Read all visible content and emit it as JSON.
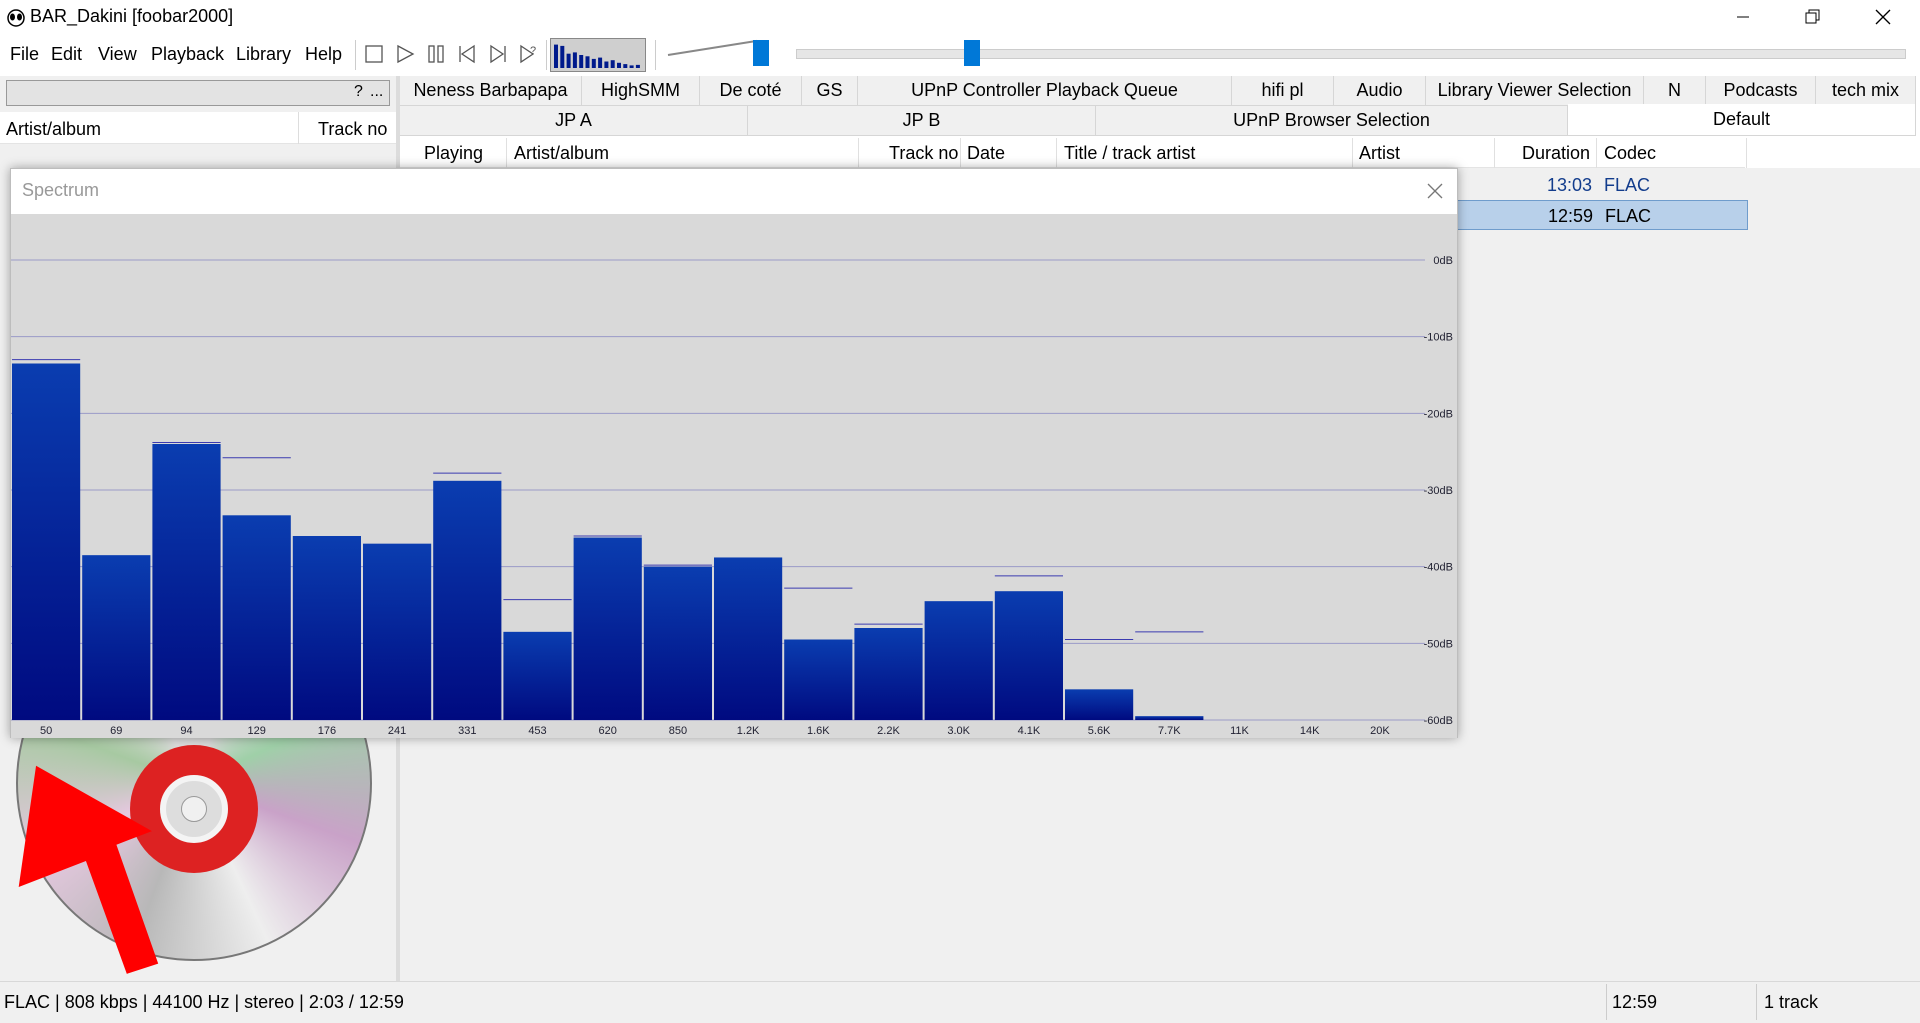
{
  "window": {
    "title": "BAR_Dakini  [foobar2000]"
  },
  "menu": [
    "File",
    "Edit",
    "View",
    "Playback",
    "Library",
    "Help"
  ],
  "toolbar": {
    "icons": [
      "stop-icon",
      "play-icon",
      "pause-icon",
      "previous-icon",
      "next-icon",
      "random-icon"
    ],
    "mini_spectrum_levels": [
      0.9,
      0.85,
      0.55,
      0.6,
      0.5,
      0.45,
      0.35,
      0.4,
      0.25,
      0.3,
      0.2,
      0.15,
      0.1,
      0.12
    ]
  },
  "library": {
    "search_q": "?",
    "search_more": "...",
    "columns": [
      "Artist/album",
      "Track no"
    ]
  },
  "tabs_row1": [
    "Neness Barbapapa",
    "HighSMM",
    "De coté",
    "GS",
    "UPnP Controller Playback Queue",
    "hifi pl",
    "Audio",
    "Library Viewer Selection",
    "N",
    "Podcasts",
    "tech mix"
  ],
  "tabs_row2": [
    "JP A",
    "JP B",
    "UPnP Browser Selection",
    "Default"
  ],
  "playlist": {
    "columns": [
      "Playing",
      "Artist/album",
      "Track no",
      "Date",
      "Title / track artist",
      "Artist",
      "Duration",
      "Codec"
    ],
    "rows": [
      {
        "duration": "13:03",
        "codec": "FLAC",
        "selected": false
      },
      {
        "duration": "12:59",
        "codec": "FLAC",
        "selected": true
      }
    ]
  },
  "spectrum": {
    "title": "Spectrum",
    "chart_data": {
      "type": "bar",
      "categories": [
        "50",
        "69",
        "94",
        "129",
        "176",
        "241",
        "331",
        "453",
        "620",
        "850",
        "1.2K",
        "1.6K",
        "2.2K",
        "3.0K",
        "4.1K",
        "5.6K",
        "7.7K",
        "11K",
        "14K",
        "20K"
      ],
      "values": [
        -13.5,
        -38.5,
        -24,
        -33.3,
        -36,
        -37,
        -28.8,
        -48.5,
        -36.2,
        -40,
        -38.8,
        -49.5,
        -48,
        -44.5,
        -43.2,
        -56,
        -59.5,
        -60,
        -60,
        -60
      ],
      "peaks": [
        -13,
        null,
        -23.8,
        -25.8,
        null,
        null,
        -27.8,
        -44.3,
        -36,
        -39.8,
        null,
        -42.8,
        -47.5,
        null,
        -41.2,
        -49.5,
        -48.5,
        null,
        null,
        null
      ],
      "ylim": [
        -60,
        0
      ],
      "y_ticks": [
        "0dB",
        "-10dB",
        "-20dB",
        "-30dB",
        "-40dB",
        "-50dB",
        "-60dB"
      ],
      "y_tick_values": [
        0,
        -10,
        -20,
        -30,
        -40,
        -50,
        -60
      ]
    }
  },
  "status": {
    "left": "FLAC | 808 kbps | 44100 Hz | stereo | 2:03 / 12:59",
    "duration": "12:59",
    "count": "1 track"
  },
  "colors": {
    "accent": "#0078d7",
    "bar_top": "#0a3db0",
    "bar_bottom": "#000a80",
    "selection": "#b8d0ea",
    "arrow": "#ff0000"
  }
}
